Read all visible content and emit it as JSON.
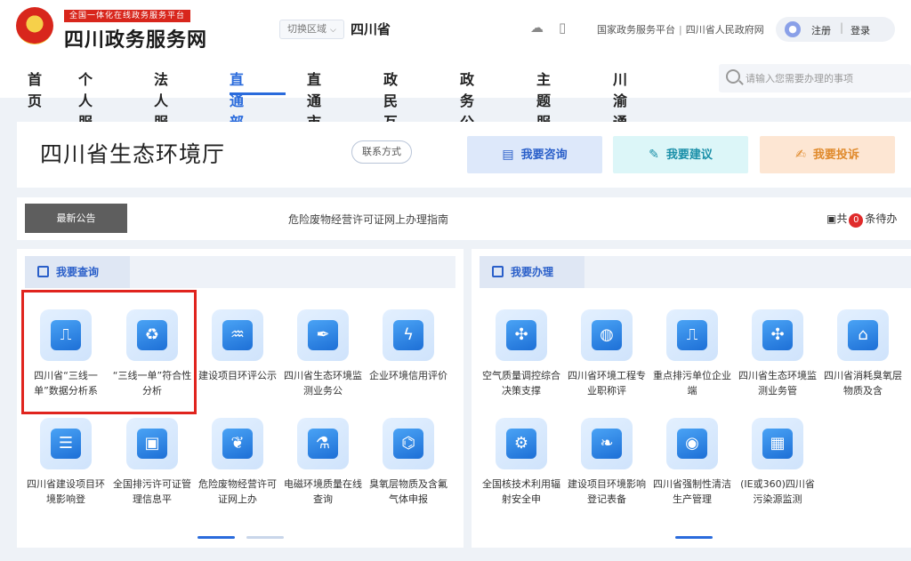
{
  "header": {
    "logo_small": "全国一体化在线政务服务平台",
    "logo_main": "四川政务服务网",
    "region_switch": "切换区域",
    "province": "四川省",
    "links": [
      "国家政务服务平台",
      "四川省人民政府网"
    ],
    "register": "注册",
    "login": "登录",
    "search_placeholder": "请输入您需要办理的事项"
  },
  "nav": {
    "items": [
      "首页",
      "个人服务",
      "法人服务",
      "直通部门",
      "直通市州",
      "政民互动",
      "政务公开",
      "主题服务",
      "川渝通办"
    ],
    "active_index": 3
  },
  "dept": {
    "title": "四川省生态环境厅",
    "contact": "联系方式",
    "consult": "我要咨询",
    "suggest": "我要建议",
    "complain": "我要投诉"
  },
  "notice": {
    "label": "最新公告",
    "text": "危险废物经营许可证网上办理指南",
    "todo_prefix": "共",
    "todo_count": "0",
    "todo_suffix": "条待办"
  },
  "query_panel": {
    "title": "我要查询",
    "items": [
      {
        "label": "四川省“三线一单”数据分析系",
        "icon": "chart-screen-icon"
      },
      {
        "label": "“三线一单”符合性分析",
        "icon": "recycle-battery-icon"
      },
      {
        "label": "建设项目环评公示",
        "icon": "water-hand-icon"
      },
      {
        "label": "四川省生态环境监测业务公",
        "icon": "pipette-icon"
      },
      {
        "label": "企业环境信用评价",
        "icon": "lightning-pin-icon"
      },
      {
        "label": "四川省建设项目环境影响登",
        "icon": "document-icon"
      },
      {
        "label": "全国排污许可证管理信息平",
        "icon": "license-card-icon"
      },
      {
        "label": "危险废物经营许可证网上办",
        "icon": "leaf-icon"
      },
      {
        "label": "电磁环境质量在线查询",
        "icon": "flask-icon"
      },
      {
        "label": "臭氧层物质及含氟气体申报",
        "icon": "molecule-icon"
      }
    ]
  },
  "handle_panel": {
    "title": "我要办理",
    "items": [
      {
        "label": "空气质量调控综合决策支撑",
        "icon": "wind-turbine-icon"
      },
      {
        "label": "四川省环境工程专业职称评",
        "icon": "globe-leaf-icon"
      },
      {
        "label": "重点排污单位企业端",
        "icon": "chart-screen-icon"
      },
      {
        "label": "四川省生态环境监测业务管",
        "icon": "wind-turbine-icon"
      },
      {
        "label": "四川省消耗臭氧层物质及含",
        "icon": "factory-roof-icon"
      },
      {
        "label": "全国核技术利用辐射安全申",
        "icon": "factory-icon"
      },
      {
        "label": "建设项目环境影响登记表备",
        "icon": "leaf-drop-icon"
      },
      {
        "label": "四川省强制性清洁生产管理",
        "icon": "leaf-circle-icon"
      },
      {
        "label": "(IE或360)四川省污染源监测",
        "icon": "solar-panel-icon"
      }
    ]
  }
}
